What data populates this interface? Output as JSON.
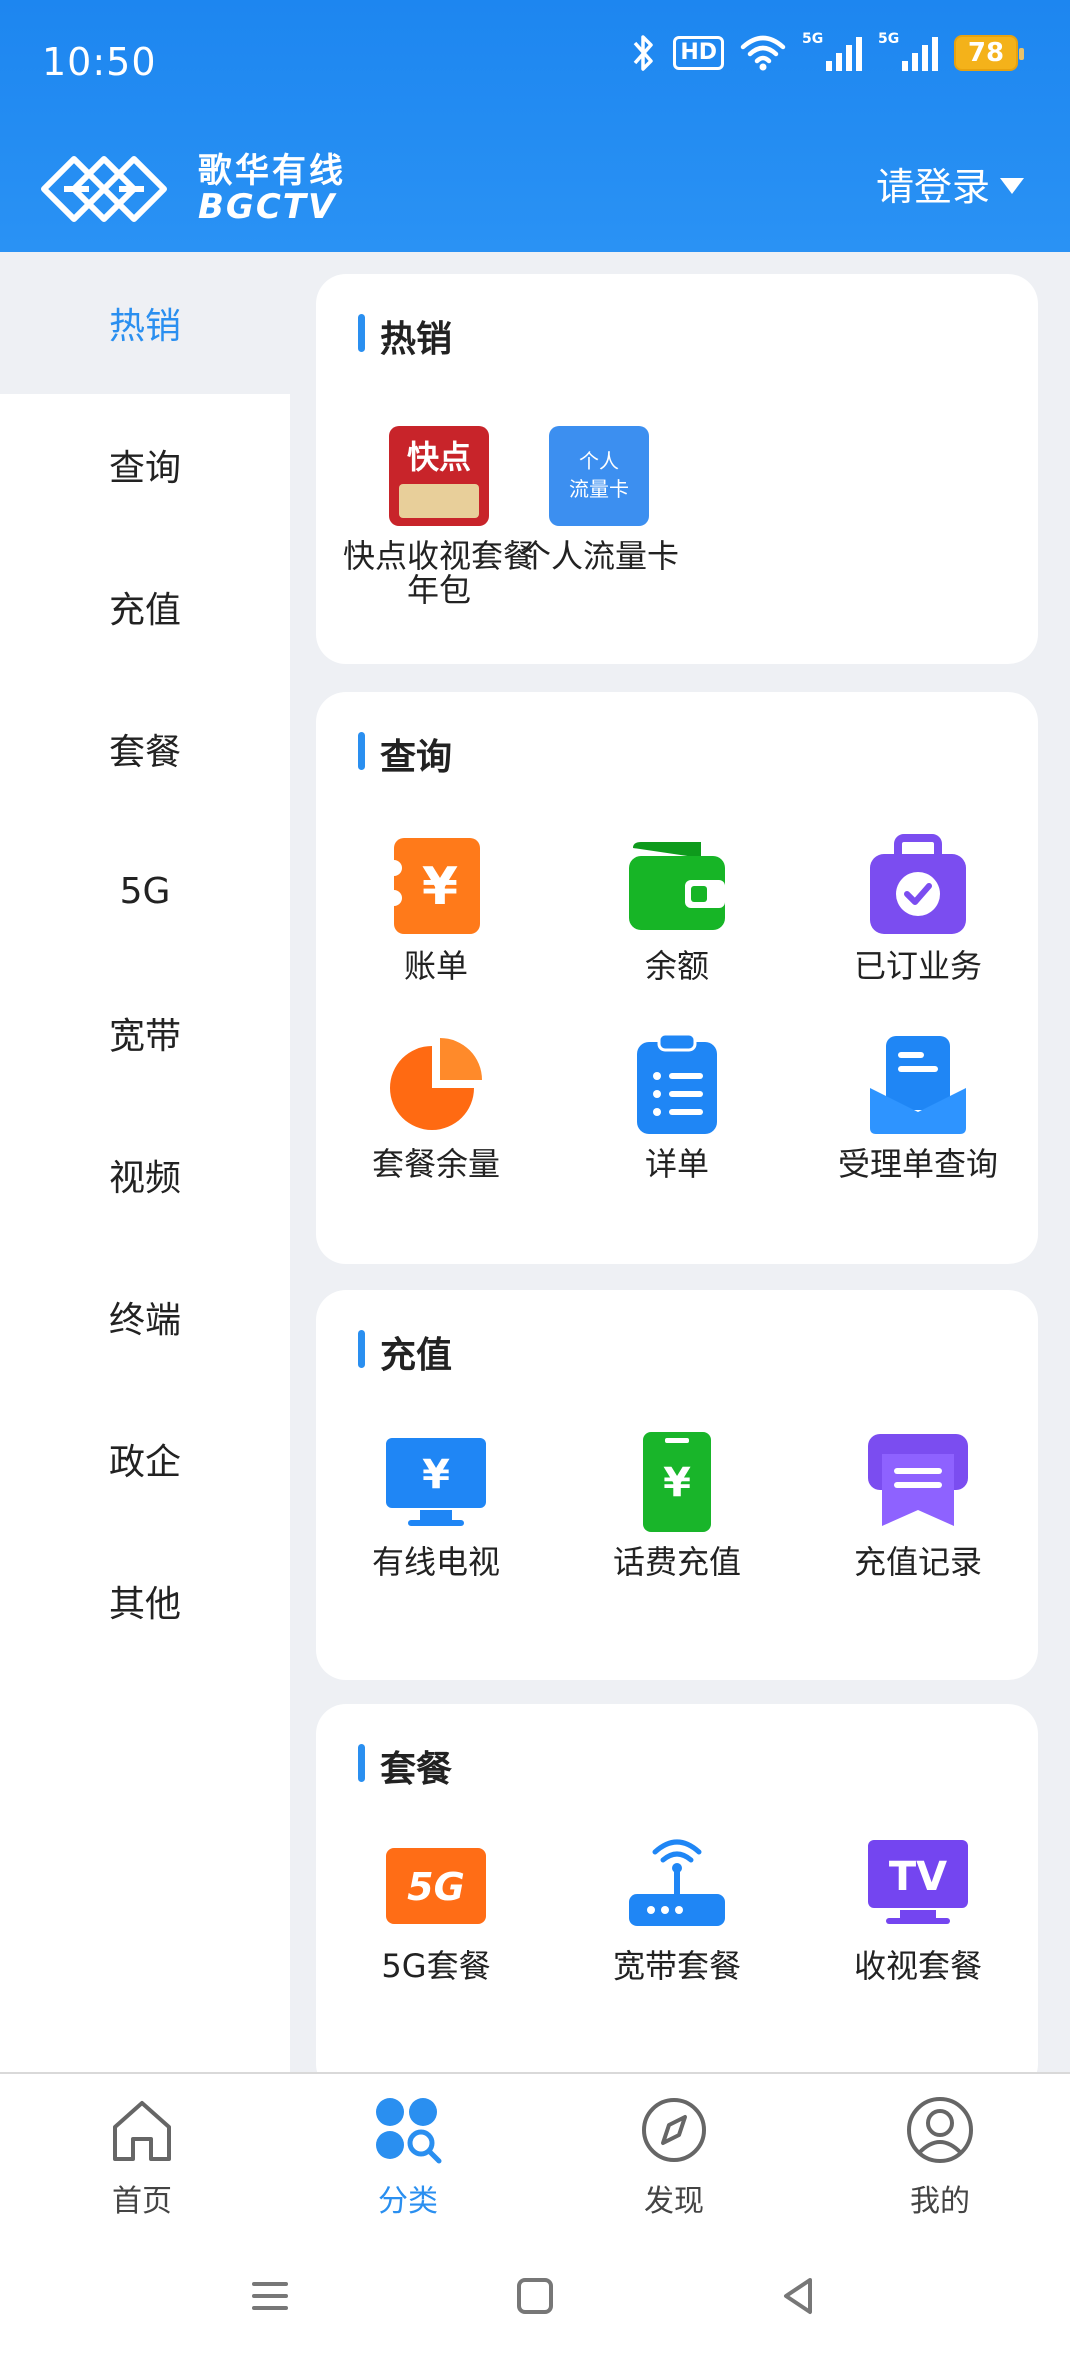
{
  "status_bar": {
    "time": "10:50",
    "hd": "HD",
    "signal_1": "5G",
    "signal_2": "5G",
    "battery": "78"
  },
  "header": {
    "brand_cn": "歌华有线",
    "brand_en": "BGCTV",
    "login_label": "请登录"
  },
  "sidebar": {
    "items": [
      {
        "label": "热销",
        "active": true
      },
      {
        "label": "查询"
      },
      {
        "label": "充值"
      },
      {
        "label": "套餐"
      },
      {
        "label": "5G"
      },
      {
        "label": "宽带"
      },
      {
        "label": "视频"
      },
      {
        "label": "终端"
      },
      {
        "label": "政企"
      },
      {
        "label": "其他"
      }
    ]
  },
  "sections": {
    "hot": {
      "title": "热销",
      "items": [
        {
          "label": "快点收视套餐年包",
          "icon": "kuaidian-package-icon",
          "thumb_text": "快点"
        },
        {
          "label": "个人流量卡",
          "icon": "data-card-icon",
          "thumb_text_1": "个人",
          "thumb_text_2": "流量卡"
        }
      ]
    },
    "query": {
      "title": "查询",
      "items": [
        {
          "label": "账单",
          "icon": "bill-icon"
        },
        {
          "label": "余额",
          "icon": "wallet-icon"
        },
        {
          "label": "已订业务",
          "icon": "subscribed-service-icon"
        },
        {
          "label": "套餐余量",
          "icon": "pie-chart-icon"
        },
        {
          "label": "详单",
          "icon": "detail-list-icon"
        },
        {
          "label": "受理单查询",
          "icon": "order-query-icon"
        }
      ]
    },
    "recharge": {
      "title": "充值",
      "items": [
        {
          "label": "有线电视",
          "icon": "tv-recharge-icon"
        },
        {
          "label": "话费充值",
          "icon": "phone-recharge-icon"
        },
        {
          "label": "充值记录",
          "icon": "recharge-record-icon"
        }
      ]
    },
    "package": {
      "title": "套餐",
      "items": [
        {
          "label": "5G套餐",
          "icon": "5g-icon",
          "badge": "5G"
        },
        {
          "label": "宽带套餐",
          "icon": "router-icon"
        },
        {
          "label": "收视套餐",
          "icon": "tv-icon",
          "badge": "TV"
        }
      ]
    }
  },
  "bottom_nav": {
    "items": [
      {
        "label": "首页",
        "icon": "home-icon"
      },
      {
        "label": "分类",
        "icon": "category-icon",
        "active": true
      },
      {
        "label": "发现",
        "icon": "compass-icon"
      },
      {
        "label": "我的",
        "icon": "profile-icon"
      }
    ]
  },
  "colors": {
    "primary": "#2a8ff0",
    "header_bg": "#1d86f0",
    "content_bg": "#eef0f4"
  }
}
